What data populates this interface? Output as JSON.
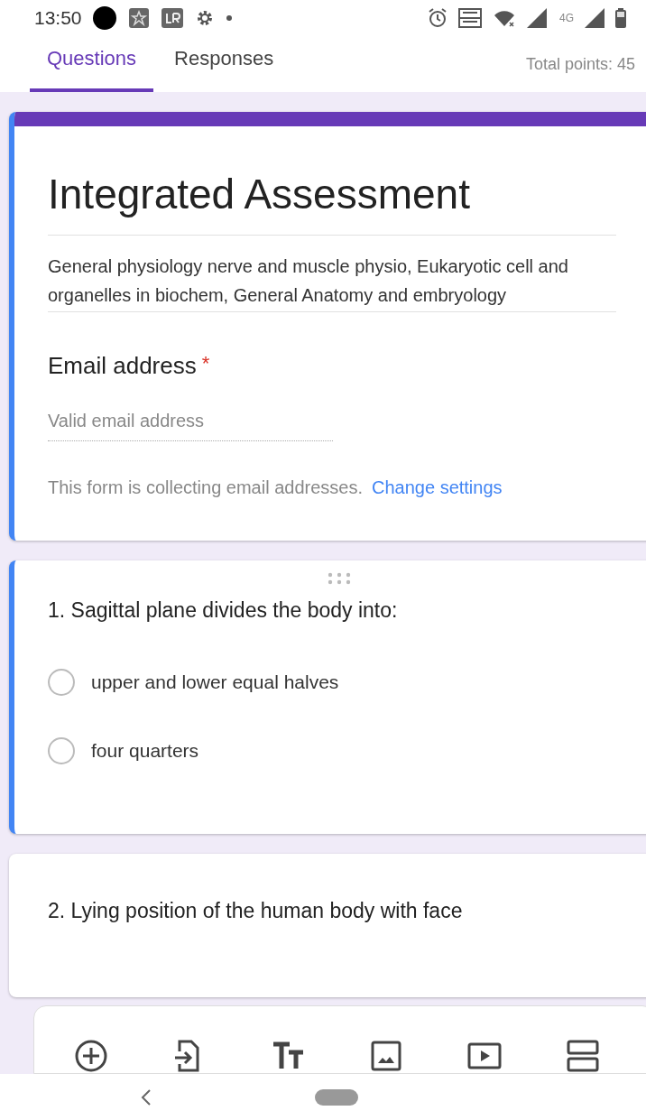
{
  "status_bar": {
    "time": "13:50",
    "network_label": "4G"
  },
  "tabs": [
    {
      "label": "Questions",
      "selected": true
    },
    {
      "label": "Responses",
      "selected": false
    }
  ],
  "total_points": "Total points: 45",
  "form": {
    "title": "Integrated Assessment",
    "description": "General physiology nerve and muscle physio, Eukaryotic cell and organelles in biochem, General Anatomy and embryology",
    "email": {
      "label": "Email address",
      "required_mark": "*",
      "placeholder": "Valid email address"
    },
    "notice": "This form is collecting email addresses.",
    "notice_link": "Change settings"
  },
  "questions": [
    {
      "title": "1. Sagittal plane divides the body into:",
      "active": true,
      "options": [
        {
          "label": "upper and lower equal halves",
          "selected": false
        },
        {
          "label": "four quarters",
          "selected": false
        }
      ]
    },
    {
      "title": "2. Lying position of the human body with face",
      "active": false
    }
  ],
  "toolbar": [
    {
      "kind": "add"
    },
    {
      "kind": "import"
    },
    {
      "kind": "title"
    },
    {
      "kind": "image"
    },
    {
      "kind": "video"
    },
    {
      "kind": "section"
    }
  ]
}
